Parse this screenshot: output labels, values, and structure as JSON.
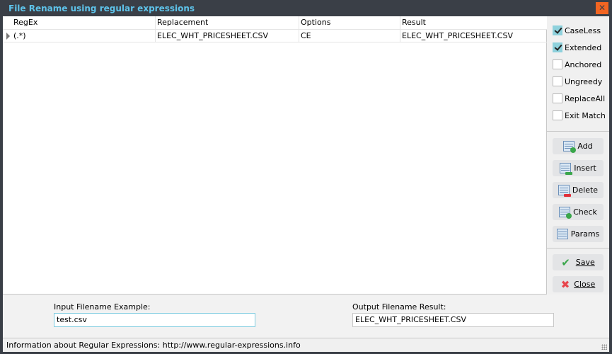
{
  "window": {
    "title": "File Rename using regular expressions",
    "close_icon": "close-x"
  },
  "grid": {
    "columns": [
      "RegEx",
      "Replacement",
      "Options",
      "Result"
    ],
    "rows": [
      {
        "regex": "(.*)",
        "replacement": "ELEC_WHT_PRICESHEET.CSV",
        "options": "CE",
        "result": "ELEC_WHT_PRICESHEET.CSV"
      }
    ]
  },
  "options": [
    {
      "label": "CaseLess",
      "checked": true
    },
    {
      "label": "Extended",
      "checked": true
    },
    {
      "label": "Anchored",
      "checked": false
    },
    {
      "label": "Ungreedy",
      "checked": false
    },
    {
      "label": "ReplaceAll",
      "checked": false
    },
    {
      "label": "Exit Match",
      "checked": false
    }
  ],
  "actions": {
    "add": "Add",
    "insert": "Insert",
    "delete": "Delete",
    "check": "Check",
    "params": "Params",
    "save": "Save",
    "close": "Close"
  },
  "input": {
    "label": "Input Filename Example:",
    "value": "test.csv"
  },
  "output": {
    "label": "Output Filename Result:",
    "value": "ELEC_WHT_PRICESHEET.CSV"
  },
  "status": "Information about Regular Expressions: http://www.regular-expressions.info",
  "colors": {
    "title": "#5ec3ea",
    "close_bg": "#f26522",
    "checked_bg": "#8ed1dc",
    "frame": "#3a3f47"
  }
}
